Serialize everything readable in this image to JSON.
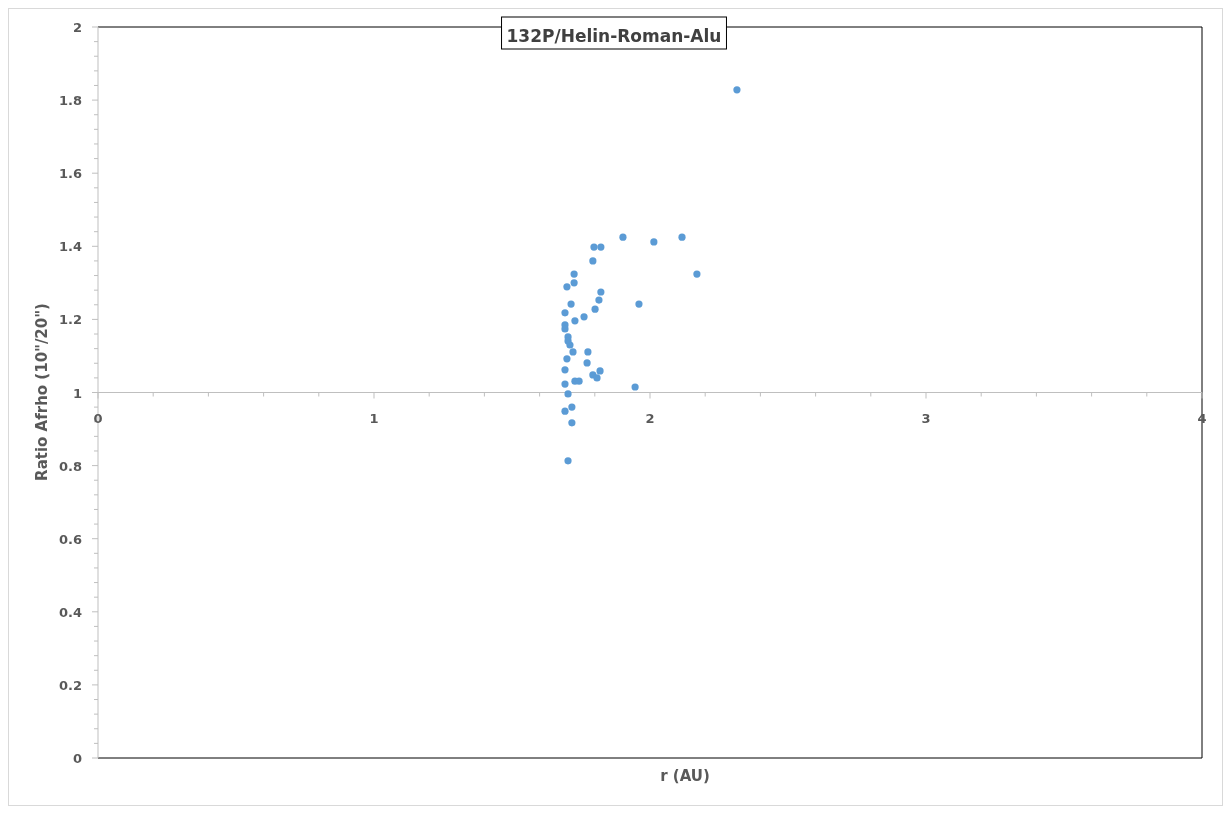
{
  "chart_data": {
    "type": "scatter",
    "title": "132P/Helin-Roman-Alu",
    "xlabel": "r (AU)",
    "ylabel": "Ratio Afrho (10\"/20\")",
    "xlim": [
      0,
      4
    ],
    "ylim": [
      0,
      2
    ],
    "xticks": [
      0,
      1,
      2,
      3,
      4
    ],
    "yticks": [
      0,
      0.2,
      0.4,
      0.6,
      0.8,
      1,
      1.2,
      1.4,
      1.6,
      1.8,
      2
    ],
    "x": [
      2.315,
      1.902,
      2.014,
      2.116,
      1.797,
      1.822,
      1.793,
      2.17,
      1.725,
      1.725,
      1.699,
      1.822,
      1.815,
      1.714,
      1.96,
      1.801,
      1.761,
      1.728,
      1.692,
      1.692,
      1.692,
      1.703,
      1.703,
      1.71,
      1.721,
      1.775,
      1.699,
      1.772,
      1.692,
      1.819,
      1.793,
      1.808,
      1.692,
      1.728,
      1.743,
      1.946,
      1.703,
      1.717,
      1.692,
      1.717,
      1.703
    ],
    "series": [
      {
        "color": "#5b9bd5",
        "values": [
          1.828,
          1.425,
          1.412,
          1.425,
          1.398,
          1.398,
          1.36,
          1.324,
          1.324,
          1.3,
          1.289,
          1.275,
          1.253,
          1.242,
          1.242,
          1.228,
          1.207,
          1.196,
          1.218,
          1.185,
          1.174,
          1.152,
          1.141,
          1.13,
          1.111,
          1.111,
          1.092,
          1.081,
          1.062,
          1.059,
          1.048,
          1.04,
          1.023,
          1.031,
          1.031,
          1.015,
          0.996,
          0.96,
          0.949,
          0.917,
          0.813
        ]
      }
    ]
  }
}
